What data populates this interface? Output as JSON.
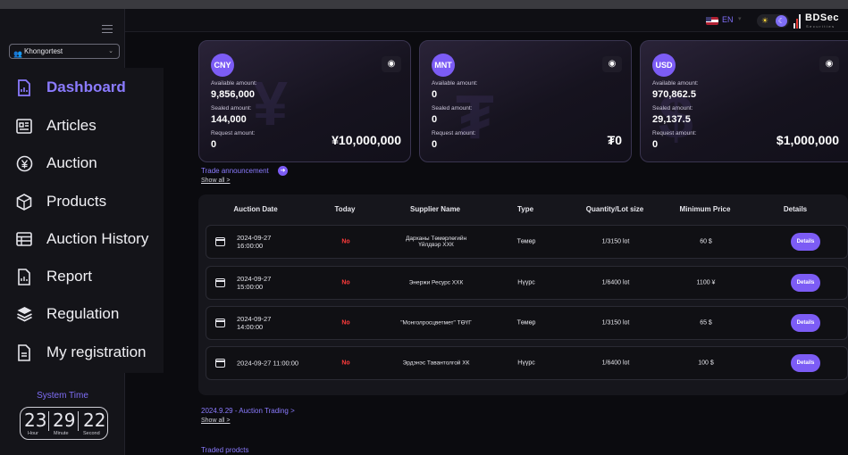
{
  "user": {
    "name": "Khongortest"
  },
  "menu": [
    {
      "label": "Dashboard",
      "icon": "dashboard-file-icon",
      "active": true
    },
    {
      "label": "Articles",
      "icon": "articles-icon"
    },
    {
      "label": "Auction",
      "icon": "auction-coin-icon"
    },
    {
      "label": "Products",
      "icon": "products-box-icon"
    },
    {
      "label": "Auction History",
      "icon": "table-icon"
    },
    {
      "label": "Report",
      "icon": "report-icon"
    },
    {
      "label": "Regulation",
      "icon": "layers-icon"
    },
    {
      "label": "My registration",
      "icon": "registration-icon"
    }
  ],
  "system_time": {
    "label": "System Time",
    "hour": "23",
    "minute": "29",
    "second": "22",
    "hour_label": "Hour",
    "minute_label": "Minute",
    "second_label": "Second"
  },
  "topbar": {
    "language": "EN",
    "brand": "BDSec",
    "brand_sub": "Securities"
  },
  "cards": [
    {
      "currency": "CNY",
      "available_label": "Available amount:",
      "available": "9,856,000",
      "sealed_label": "Sealed amount:",
      "sealed": "144,000",
      "request_label": "Request amount:",
      "request": "0",
      "total": "¥10,000,000",
      "watermark": "¥"
    },
    {
      "currency": "MNT",
      "available_label": "Available amount:",
      "available": "0",
      "sealed_label": "Sealed amount:",
      "sealed": "0",
      "request_label": "Request amount:",
      "request": "0",
      "total": "₮0",
      "watermark": "₮"
    },
    {
      "currency": "USD",
      "available_label": "Available amount:",
      "available": "970,862.5",
      "sealed_label": "Sealed amount:",
      "sealed": "29,137.5",
      "request_label": "Request amount:",
      "request": "0",
      "total": "$1,000,000",
      "watermark": "$"
    }
  ],
  "trade_announcement": {
    "title": "Trade announcement",
    "show_all": "Show all >"
  },
  "table": {
    "headers": [
      "Auction Date",
      "Today",
      "Supplier Name",
      "Type",
      "Quantity/Lot size",
      "Minimum Price",
      "Details"
    ],
    "rows": [
      {
        "date": "2024-09-27",
        "time": "16:00:00",
        "today": "No",
        "supplier": "Дарханы Төмөрлөгийн",
        "supplier2": "Үйлдвэр ХХК",
        "type": "Төмөр",
        "qty": "1/3150 lot",
        "price": "60 $",
        "details": "Details"
      },
      {
        "date": "2024-09-27",
        "time": "15:00:00",
        "today": "No",
        "supplier": "Энержи Ресурс ХХК",
        "supplier2": "",
        "type": "Нүүрс",
        "qty": "1/6400 lot",
        "price": "1100 ¥",
        "details": "Details"
      },
      {
        "date": "2024-09-27",
        "time": "14:00:00",
        "today": "No",
        "supplier": "\"Монголросцветмет\" ТӨҮГ",
        "supplier2": "",
        "type": "Төмөр",
        "qty": "1/3150 lot",
        "price": "65 $",
        "details": "Details"
      },
      {
        "date": "2024-09-27 11:00:00",
        "time": "",
        "today": "No",
        "supplier": "Эрдэнэс Тавантолгой ХК",
        "supplier2": "",
        "type": "Нүүрс",
        "qty": "1/6400 lot",
        "price": "100 $",
        "details": "Details"
      }
    ]
  },
  "auction_trading": {
    "title": "2024.9.29 - Auction Trading >",
    "show_all": "Show all >"
  },
  "traded_products": {
    "title": "Traded prodcts"
  },
  "colors": {
    "accent": "#7c5cf5",
    "accent_text": "#8b7bff",
    "no": "#ff3b3b",
    "background": "#0b0b0f"
  }
}
